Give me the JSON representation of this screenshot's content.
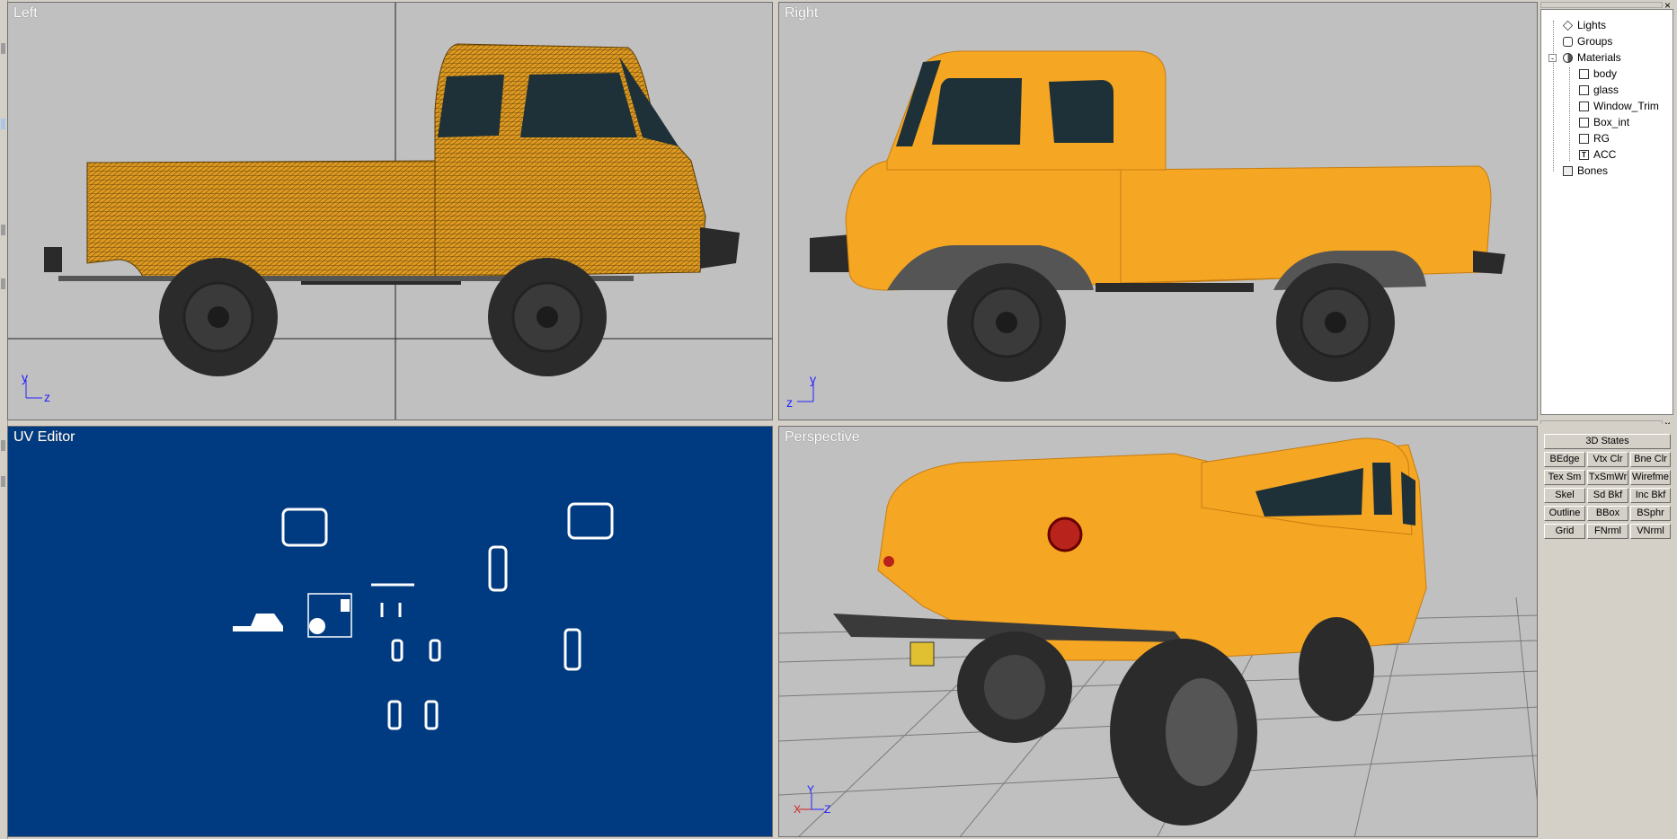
{
  "viewports": {
    "left": {
      "title": "Left",
      "axis_up": "y",
      "axis_right": "z"
    },
    "right": {
      "title": "Right",
      "axis_up": "y",
      "axis_right": "z"
    },
    "uv": {
      "title": "UV Editor"
    },
    "perspective": {
      "title": "Perspective",
      "axis_up": "Y",
      "axis_left": "X",
      "axis_right": "Z"
    }
  },
  "tree": {
    "items": [
      {
        "label": "Lights",
        "icon": "light-icon"
      },
      {
        "label": "Groups",
        "icon": "groups-icon"
      },
      {
        "label": "Materials",
        "icon": "materials-icon",
        "expanded": "-"
      },
      {
        "label": "body",
        "icon": "material-square-icon"
      },
      {
        "label": "glass",
        "icon": "material-square-icon"
      },
      {
        "label": "Window_Trim",
        "icon": "material-square-icon"
      },
      {
        "label": "Box_int",
        "icon": "material-square-icon"
      },
      {
        "label": "RG",
        "icon": "material-square-icon"
      },
      {
        "label": "ACC",
        "icon": "texture-icon"
      },
      {
        "label": "Bones",
        "icon": "bones-icon"
      }
    ]
  },
  "states": {
    "header": "3D States",
    "buttons": [
      "BEdge",
      "Vtx Clr",
      "Bne Clr",
      "Tex Sm",
      "TxSmWr",
      "Wirefme",
      "Skel",
      "Sd Bkf",
      "Inc Bkf",
      "Outline",
      "BBox",
      "BSphr",
      "Grid",
      "FNrml",
      "VNrml"
    ]
  },
  "colors": {
    "truck_body": "#f5a623",
    "uv_background": "#003a80",
    "viewport_bg": "#c0c0c0",
    "window_tint": "#1e3038"
  },
  "close_glyph": "×"
}
